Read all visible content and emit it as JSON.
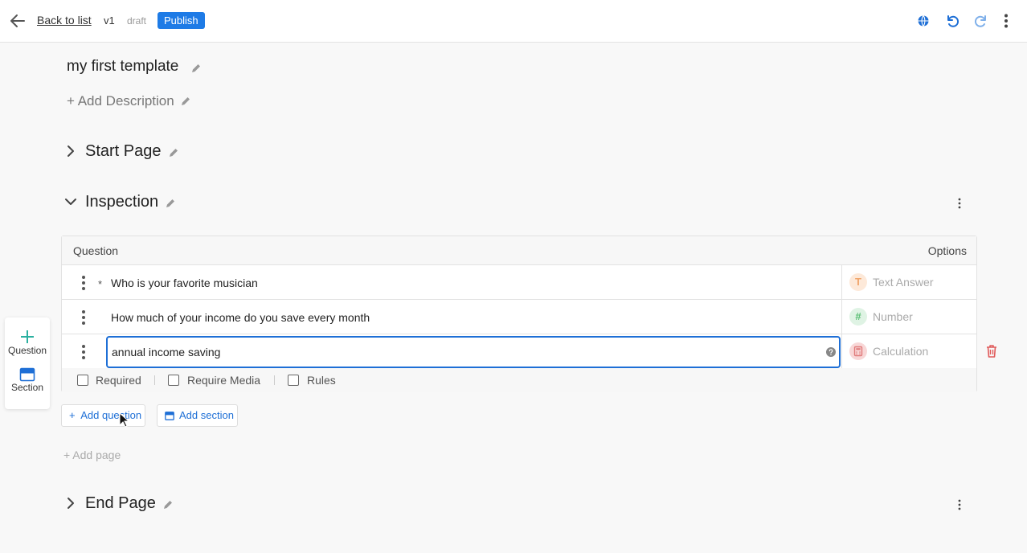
{
  "topbar": {
    "back_label": "Back to list",
    "version": "v1",
    "status": "draft",
    "publish_label": "Publish"
  },
  "template": {
    "title": "my first template",
    "add_description": "+ Add Description"
  },
  "pages": {
    "start": "Start Page",
    "inspection": "Inspection",
    "end": "End Page"
  },
  "table": {
    "col_question": "Question",
    "col_options": "Options",
    "rows": [
      {
        "text": "Who is your favorite musician",
        "required_mark": "*",
        "type": "Text Answer",
        "type_glyph": "T"
      },
      {
        "text": "How much of your income do you save every month",
        "type": "Number",
        "type_glyph": "#"
      },
      {
        "text": "annual income saving",
        "type": "Calculation"
      }
    ],
    "options": {
      "required": "Required",
      "require_media": "Require Media",
      "rules": "Rules"
    }
  },
  "sidebar": {
    "question": "Question",
    "section": "Section"
  },
  "actions": {
    "add_question": "Add question",
    "add_section": "Add section",
    "add_question_prefix": "+",
    "add_page": "+ Add page"
  },
  "colors": {
    "accent": "#1e7be6",
    "text_answer_tint": "#fde9d9",
    "number_tint": "#dff3e4",
    "calculation_tint": "#f8d7d7",
    "danger": "#e05a5a"
  }
}
